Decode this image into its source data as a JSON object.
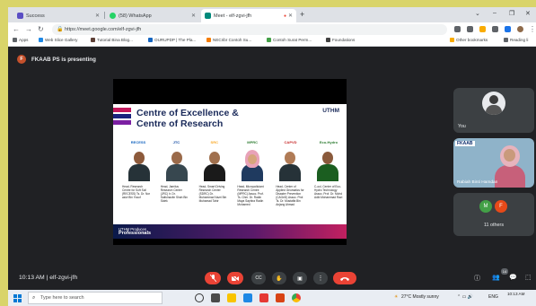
{
  "browser": {
    "tabs": [
      {
        "title": "Success",
        "color": "#5b4fc4"
      },
      {
        "title": "(58) WhatsApp",
        "color": "#25d366"
      },
      {
        "title": "Meet - elf-zgvi-jfh",
        "color": "#00897b",
        "active": true
      }
    ],
    "url": "https://meet.google.com/elf-zgvi-jfh",
    "bookmarks": [
      {
        "label": "Apps",
        "color": "#5f6368"
      },
      {
        "label": "Web Slice Gallery",
        "color": "#1e88e5"
      },
      {
        "label": "Tutorial Bina Blog...",
        "color": "#5d4037"
      },
      {
        "label": "OURUPDP | The Pla...",
        "color": "#1565c0"
      },
      {
        "label": "NECribr Contoh Su...",
        "color": "#f57c00"
      },
      {
        "label": "Contoh Surat Perm...",
        "color": "#43a047"
      },
      {
        "label": "Foundations",
        "color": "#424242"
      },
      {
        "label": "Other bookmarks",
        "color": "#f9ab00"
      },
      {
        "label": "Reading li",
        "color": "#5f6368"
      }
    ]
  },
  "meet": {
    "presenter_initial": "F",
    "presenting_text": "FKAAB PS is presenting",
    "slide": {
      "title_line1": "Centre of Excellence &",
      "title_line2": "Centre of Research",
      "brand": "UTHM",
      "logos": [
        "RECESS",
        "JTC",
        "SRC",
        "MPRC",
        "CAPVD",
        "Eco-Hydro"
      ],
      "captions": [
        "Head, Research Centre for Soft Soil (RECESS) Ts. Dr. Nor azizi Bin Yusof",
        "Head, Jamilus Research Center (JRC) Ir. Dr. Saifulnazlin Shah Bin Sidek",
        "Head, Smart Driving Research Center (SDRC) Dr. Muhammad Nazri Bin Muhamad Tahir",
        "Head, Micropollutant Research Centre (MPRC) Assoc. Prof. Ts. Chm. Dr. Radin Maya Saphira Radin Mohamed",
        "Head, Center of Applied Geomatics for Disaster Prevention (CAGeD) Assoc. Prof. Ts. Dr. Mustaffa Bin Anjang Ahmad",
        "C-ool, Center of Eco-Hydro Technology Assoc. Prof. Dr. Mohd Adib Mohammad Razi"
      ],
      "footer_line1": "UTHM Produces",
      "footer_line2": "Professionals"
    },
    "participants": {
      "you_label": "You",
      "camera_banner": "FKAAB",
      "camera_name": "Rabiah Binti Hamdan",
      "others_initials": [
        "M",
        "F"
      ],
      "others_count": "11 others"
    },
    "bottom": {
      "time_code": "10:13 AM | elf-zgvi-jfh",
      "participant_badge": "14"
    }
  },
  "taskbar": {
    "search_placeholder": "Type here to search",
    "weather": "27°C  Mostly sunny",
    "lang": "ENG",
    "time": "10:13 AM"
  }
}
